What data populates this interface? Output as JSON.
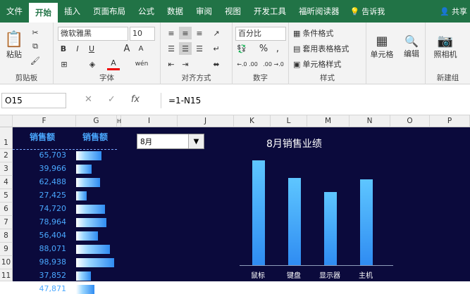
{
  "menu": {
    "items": [
      "文件",
      "开始",
      "插入",
      "页面布局",
      "公式",
      "数据",
      "审阅",
      "视图",
      "开发工具",
      "福昕阅读器"
    ],
    "active": "开始",
    "tell_me": "告诉我",
    "share": "共享"
  },
  "ribbon": {
    "clipboard": {
      "paste": "粘贴",
      "label": "剪贴板"
    },
    "font": {
      "name": "微软雅黑",
      "size": "10",
      "label": "字体",
      "bold": "B",
      "italic": "I",
      "underline": "U",
      "grow": "A",
      "shrink": "A",
      "font_color": "A",
      "wen": "wén"
    },
    "alignment": {
      "label": "对齐方式"
    },
    "number": {
      "format": "百分比",
      "percent": "%",
      "comma": ",",
      "label": "数字",
      "inc": "←.0 .00",
      "dec": ".00 →.0"
    },
    "styles": {
      "conditional": "条件格式",
      "table": "套用表格格式",
      "cell": "单元格样式",
      "label": "样式"
    },
    "cells": {
      "label": "单元格"
    },
    "editing": {
      "label": "编辑"
    },
    "camera": {
      "label": "照相机",
      "group": "新建组"
    }
  },
  "formula_bar": {
    "name_box": "O15",
    "cancel": "✕",
    "enter": "✓",
    "fx": "fx",
    "formula": "=1-N15"
  },
  "columns": [
    "F",
    "G",
    "H",
    "I",
    "J",
    "K",
    "L",
    "M",
    "N",
    "O",
    "P"
  ],
  "rows": [
    "1",
    "2",
    "3",
    "4",
    "5",
    "6",
    "7",
    "8",
    "9",
    "10",
    "11"
  ],
  "sheet": {
    "header_f": "销售额",
    "header_g": "销售额",
    "values": [
      "65,703",
      "39,966",
      "62,488",
      "27,425",
      "74,720",
      "78,964",
      "56,404",
      "88,071",
      "98,938",
      "37,852",
      "47,871"
    ],
    "bar_values": [
      65703,
      39966,
      62488,
      27425,
      74720,
      78964,
      56404,
      88071,
      98938,
      37852,
      47871
    ],
    "dropdown": "8月"
  },
  "chart_data": {
    "type": "bar",
    "title": "8月销售业绩",
    "categories": [
      "鼠标",
      "键盘",
      "显示器",
      "主机"
    ],
    "values": [
      0.82,
      0.68,
      0.57,
      0.67
    ],
    "ylim": [
      0,
      1
    ],
    "grid": false,
    "legend": "none"
  },
  "colors": {
    "ribbon_green": "#217346",
    "sheet_bg": "#0b0a3c",
    "accent_blue": "#4aa8ff"
  }
}
